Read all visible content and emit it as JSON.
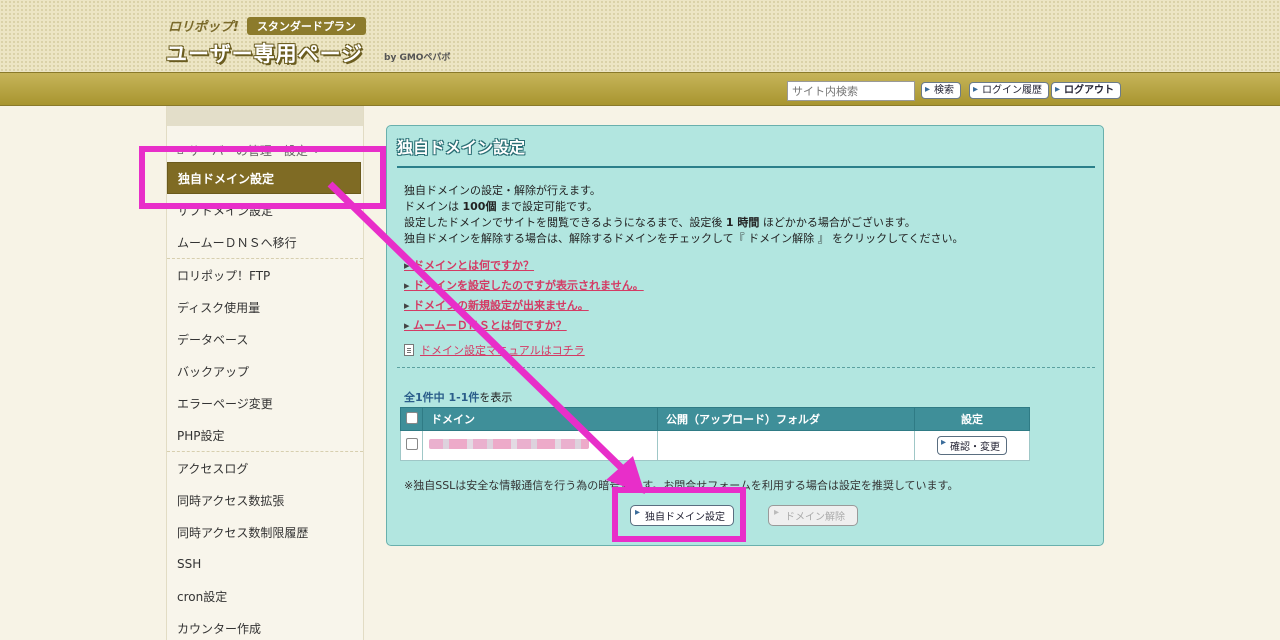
{
  "header": {
    "brand_small": "ロリポップ!",
    "plan_badge": "スタンダードプラン",
    "title": "ユーザー専用ページ",
    "by": "by GMOペパボ"
  },
  "toolbar": {
    "search_placeholder": "サイト内検索",
    "search_button": "検索",
    "login_history_button": "ログイン履歴",
    "logout_button": "ログアウト"
  },
  "sidebar": {
    "section_title": "サーバーの管理・設定",
    "items": [
      {
        "label": "独自ドメイン設定",
        "active": true
      },
      {
        "label": "サブドメイン設定"
      },
      {
        "label": "ムームーＤＮＳへ移行"
      },
      {
        "label": "ロリポップ！FTP"
      },
      {
        "label": "ディスク使用量"
      },
      {
        "label": "データベース"
      },
      {
        "label": "バックアップ"
      },
      {
        "label": "エラーページ変更"
      },
      {
        "label": "PHP設定"
      },
      {
        "label": "アクセスログ"
      },
      {
        "label": "同時アクセス数拡張"
      },
      {
        "label": "同時アクセス数制限履歴"
      },
      {
        "label": "SSH"
      },
      {
        "label": "cron設定"
      },
      {
        "label": "カウンター作成"
      }
    ]
  },
  "main": {
    "title": "独自ドメイン設定",
    "desc": {
      "line1": "独自ドメインの設定・解除が行えます。",
      "line2_pre": "ドメインは ",
      "line2_bold": "100個",
      "line2_post": " まで設定可能です。",
      "line3_pre": "設定したドメインでサイトを閲覧できるようになるまで、設定後 ",
      "line3_bold": "1 時間",
      "line3_post": " ほどかかる場合がございます。",
      "line4": "独自ドメインを解除する場合は、解除するドメインをチェックして『 ドメイン解除 』 をクリックしてください。"
    },
    "faq": [
      "ドメインとは何ですか？",
      "ドメインを設定したのですが表示されません。",
      "ドメインの新規設定が出来ません。",
      "ムームーＤＮＳとは何ですか？"
    ],
    "manual_link": "ドメイン設定マニュアルはコチラ",
    "count_bold": "全1件中 1-1件",
    "count_suffix": "を表示",
    "table": {
      "headers": [
        "ドメイン",
        "公開（アップロード）フォルダ",
        "設定"
      ],
      "rows": [
        {
          "domain": "",
          "folder": "",
          "action": "確認・変更"
        }
      ]
    },
    "note": "※独自SSLは安全な情報通信を行う為の暗号化です。お問合せフォームを利用する場合は設定を推奨しています。",
    "set_button": "独自ドメイン設定",
    "remove_button": "ドメイン解除"
  },
  "colors": {
    "annotation": "#e82ec9",
    "panel_bg": "#b2e6e0",
    "active_item": "#7f6b24",
    "link": "#d43a64"
  }
}
